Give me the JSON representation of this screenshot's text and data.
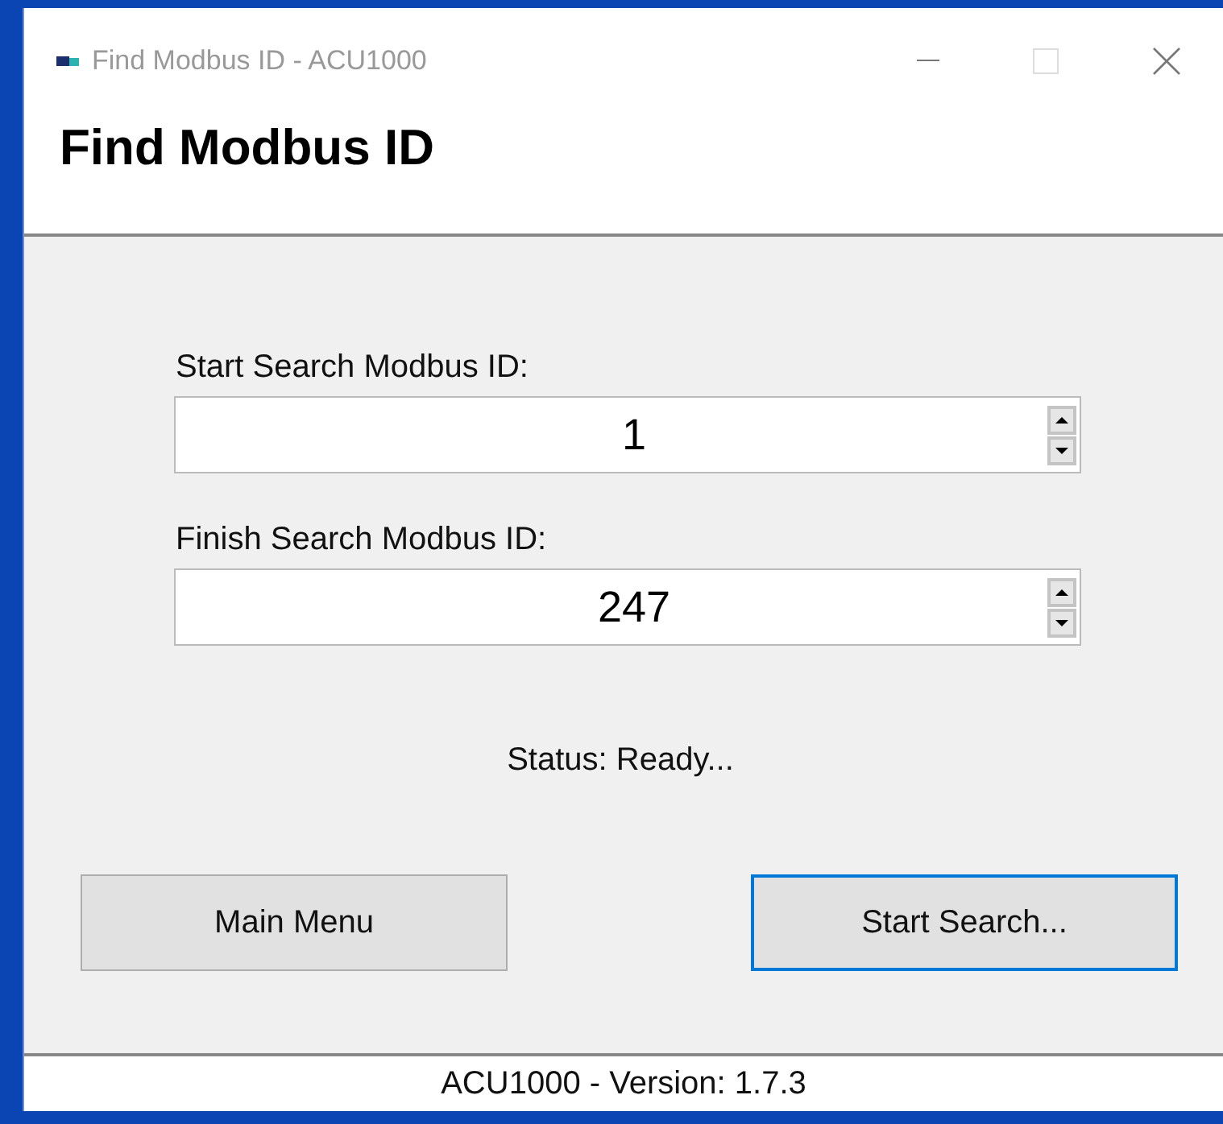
{
  "window": {
    "title": "Find Modbus ID - ACU1000"
  },
  "header": {
    "title": "Find Modbus ID"
  },
  "fields": [
    {
      "label": "Start Search Modbus ID:",
      "value": "1"
    },
    {
      "label": "Finish Search Modbus ID:",
      "value": "247"
    }
  ],
  "status": "Status: Ready...",
  "buttons": [
    {
      "label": "Main Menu",
      "focused": false
    },
    {
      "label": "Start Search...",
      "focused": true
    }
  ],
  "status_bar": "ACU1000 - Version: 1.7.3"
}
